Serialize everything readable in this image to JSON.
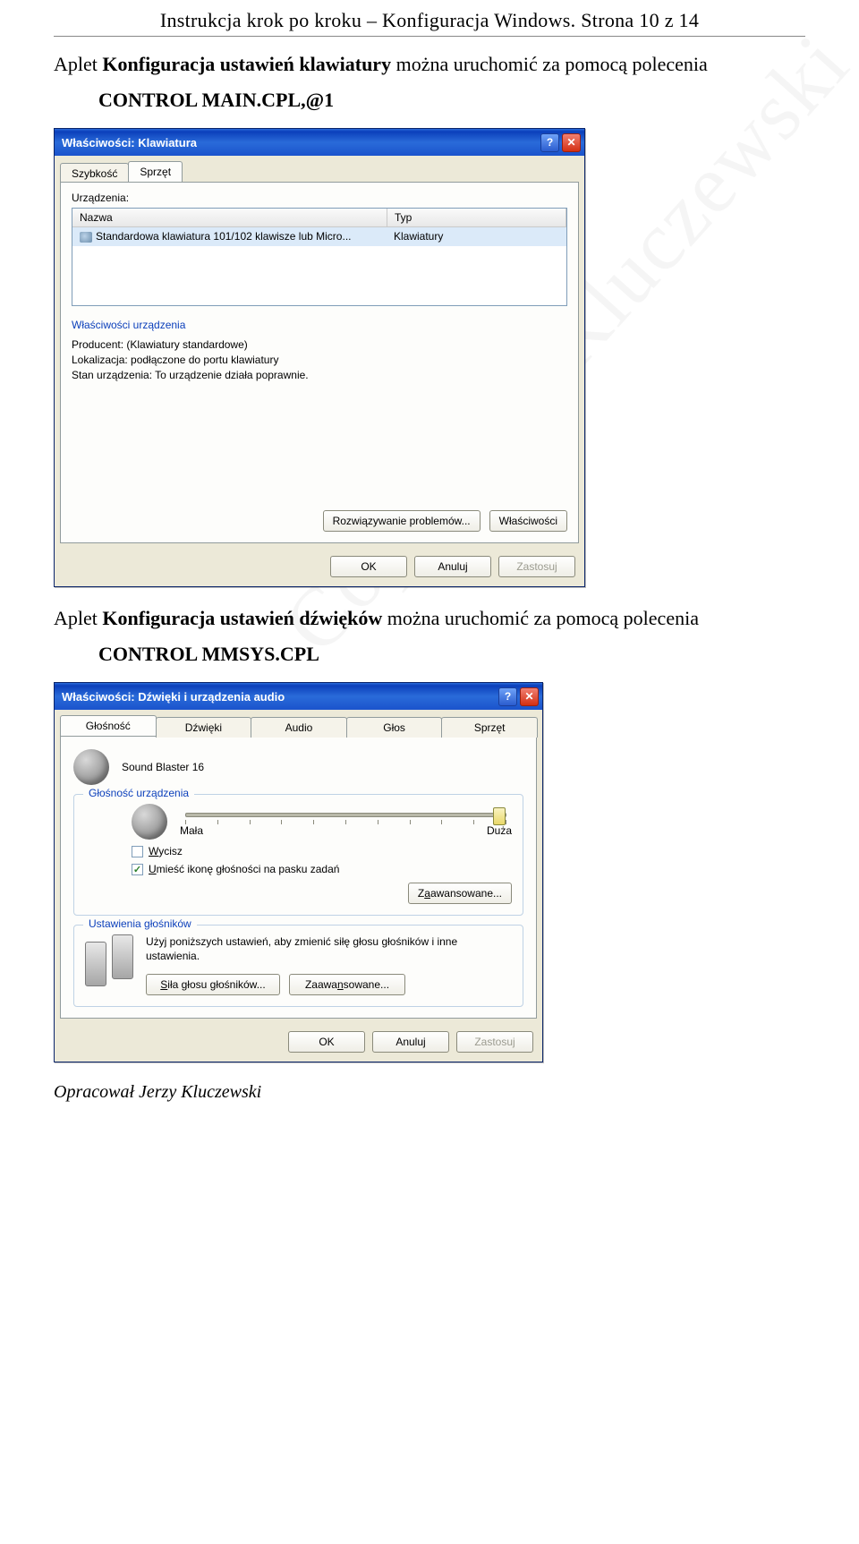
{
  "doc": {
    "header": "Instrukcja krok po kroku – Konfiguracja Windows.  Strona 10 z 14",
    "para1_a": "Aplet ",
    "para1_b": "Konfiguracja ustawień klawiatury",
    "para1_c": "  można uruchomić za pomocą polecenia",
    "cmd1": "CONTROL  MAIN.CPL,@1",
    "para2_a": "Aplet ",
    "para2_b": "Konfiguracja ustawień dźwięków",
    "para2_c": "  można uruchomić za pomocą polecenia",
    "cmd2": "CONTROL  MMSYS.CPL",
    "footer": "Opracował Jerzy Kluczewski",
    "watermark": "Copyright Kluczewski"
  },
  "kb_dialog": {
    "title": "Właściwości: Klawiatura",
    "help": "?",
    "close": "✕",
    "tabs": {
      "speed": "Szybkość",
      "hardware": "Sprzęt"
    },
    "devices_label": "Urządzenia:",
    "col_name": "Nazwa",
    "col_type": "Typ",
    "row_name": "Standardowa klawiatura 101/102 klawisze lub Micro...",
    "row_type": "Klawiatury",
    "props_title": "Właściwości urządzenia",
    "manufacturer": "Producent: (Klawiatury standardowe)",
    "location": "Lokalizacja: podłączone do portu klawiatury",
    "status": "Stan urządzenia: To urządzenie działa poprawnie.",
    "btn_troubleshoot": "Rozwiązywanie problemów...",
    "btn_props": "Właściwości",
    "btn_ok": "OK",
    "btn_cancel": "Anuluj",
    "btn_apply": "Zastosuj"
  },
  "audio_dialog": {
    "title": "Właściwości: Dźwięki i urządzenia audio",
    "help": "?",
    "close": "✕",
    "tabs": [
      "Głośność",
      "Dźwięki",
      "Audio",
      "Głos",
      "Sprzęt"
    ],
    "device_name": "Sound Blaster 16",
    "volume_group": "Głośność urządzenia",
    "vol_low": "Mała",
    "vol_high": "Duża",
    "chk_mute": "Wycisz",
    "chk_tray": "Umieść ikonę głośności na pasku zadań",
    "btn_adv1": "Zaawansowane...",
    "spk_group": "Ustawienia głośników",
    "spk_text": "Użyj poniższych ustawień, aby zmienić siłę głosu głośników i inne ustawienia.",
    "btn_spk_vol": "Siła głosu głośników...",
    "btn_adv2": "Zaawansowane...",
    "btn_ok": "OK",
    "btn_cancel": "Anuluj",
    "btn_apply": "Zastosuj"
  }
}
